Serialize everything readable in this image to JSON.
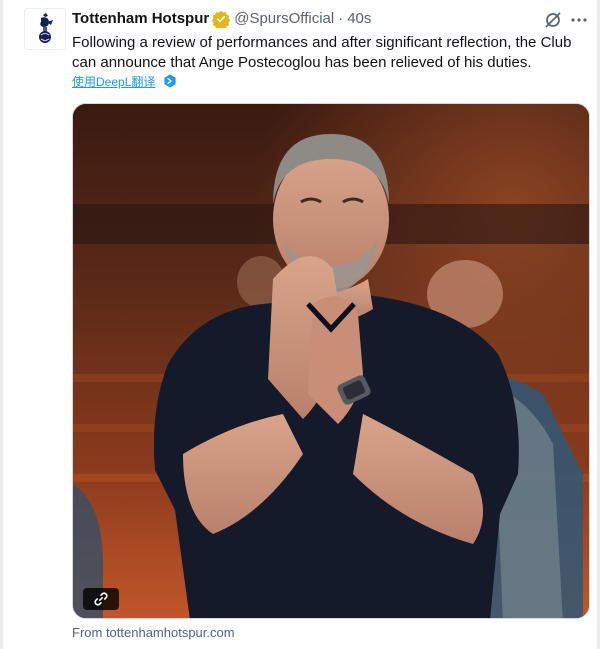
{
  "tweet": {
    "display_name": "Tottenham Hotspur",
    "handle": "@SpursOfficial",
    "separator": "·",
    "time": "40s",
    "text": "Following a review of performances and after significant reflection, the Club can announce that Ange Postecoglou has been relieved of his duties.",
    "translate_label": "使用DeepL翻译",
    "source": "From tottenhamhotspur.com"
  },
  "icons": {
    "avatar": "tottenham-cockerel-logo",
    "verified": "gold-verified-badge",
    "grok": "grok-icon",
    "more": "more-dots-icon",
    "translate_badge": "deepl-badge-icon",
    "link": "link-icon"
  },
  "colors": {
    "link_blue": "#1d9bf0",
    "verified_gold": "#e2b719",
    "secondary_text": "#536471",
    "background": "#ebebeb"
  }
}
